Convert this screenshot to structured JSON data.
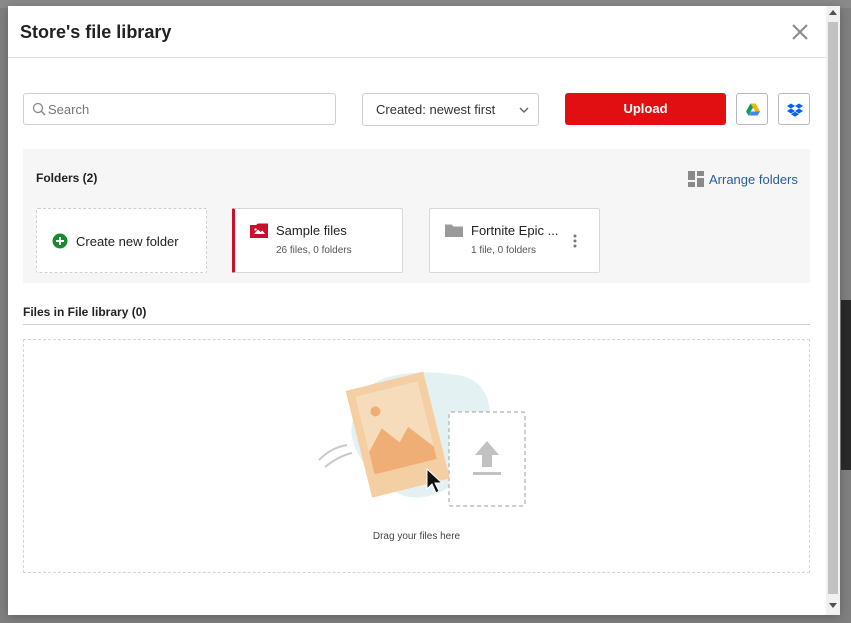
{
  "modal": {
    "title": "Store's file library"
  },
  "toolbar": {
    "search_placeholder": "Search",
    "sort_label": "Created: newest first",
    "upload_label": "Upload",
    "google_drive_icon": "google-drive-icon",
    "dropbox_icon": "dropbox-icon"
  },
  "folders": {
    "heading": "Folders (2)",
    "arrange_label": "Arrange folders",
    "create_label": "Create new folder",
    "items": [
      {
        "name": "Sample files",
        "meta": "26 files, 0 folders",
        "icon": "image-folder-icon"
      },
      {
        "name": "Fortnite Epic ...",
        "meta": "1 file, 0 folders",
        "icon": "folder-icon"
      }
    ]
  },
  "files": {
    "heading": "Files in File library (0)",
    "drop_text": "Drag your files here"
  },
  "colors": {
    "accent": "#e10f12",
    "link": "#2a5c9e",
    "create_green": "#1a8a2e"
  }
}
